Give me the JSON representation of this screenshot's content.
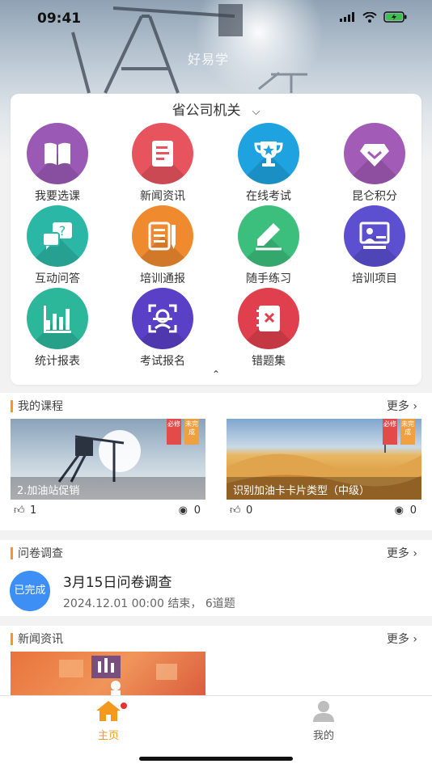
{
  "status_bar": {
    "time": "09:41"
  },
  "header": {
    "brand": "好易学"
  },
  "org_selector": {
    "label": "省公司机关"
  },
  "menu": [
    {
      "label": "我要选课",
      "icon": "open-book-icon",
      "color": "#9b59b6"
    },
    {
      "label": "新闻资讯",
      "icon": "news-document-icon",
      "color": "#e8545e"
    },
    {
      "label": "在线考试",
      "icon": "trophy-icon",
      "color": "#1ea3e0"
    },
    {
      "label": "昆仑积分",
      "icon": "diamond-icon",
      "color": "#a35bb8"
    },
    {
      "label": "互动问答",
      "icon": "question-chat-icon",
      "color": "#2bb7a5"
    },
    {
      "label": "培训通报",
      "icon": "bulletin-icon",
      "color": "#ef8a2f"
    },
    {
      "label": "随手练习",
      "icon": "pencil-practice-icon",
      "color": "#3cbf7d"
    },
    {
      "label": "培训项目",
      "icon": "presentation-icon",
      "color": "#5c4fd0"
    },
    {
      "label": "统计报表",
      "icon": "bar-chart-icon",
      "color": "#2cb79b"
    },
    {
      "label": "考试报名",
      "icon": "face-scan-icon",
      "color": "#5a3fc7"
    },
    {
      "label": "错题集",
      "icon": "wrong-notebook-icon",
      "color": "#e0404e"
    }
  ],
  "courses_section": {
    "title": "我的课程",
    "more": "更多",
    "items": [
      {
        "title": "2.加油站促销",
        "likes": "1",
        "views": "0",
        "ribbon_required": "必修",
        "ribbon_status": "未完成"
      },
      {
        "title": "识别加油卡卡片类型（中级）",
        "likes": "0",
        "views": "0",
        "ribbon_required": "必修",
        "ribbon_status": "未完成"
      }
    ]
  },
  "survey_section": {
    "title": "问卷调查",
    "more": "更多",
    "badge": "已完成",
    "survey_title": "3月15日问卷调查",
    "survey_subtitle": "2024.12.01 00:00 结束，  6道题"
  },
  "news_section": {
    "title": "新闻资讯",
    "more": "更多"
  },
  "tabbar": {
    "home": "主页",
    "mine": "我的"
  },
  "colors": {
    "accent": "#f39a1e",
    "badge_blue": "#3d8ff5",
    "notify_red": "#e83030"
  }
}
